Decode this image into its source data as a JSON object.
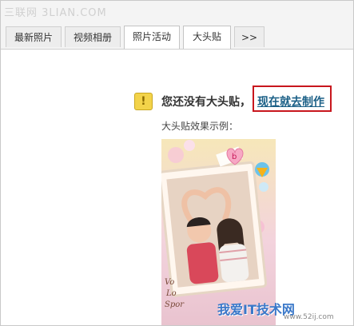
{
  "watermark_top": "三联网 3LIAN.COM",
  "tabs": [
    {
      "label": "最新照片",
      "active": false
    },
    {
      "label": "视频相册",
      "active": false
    },
    {
      "label": "照片活动",
      "active": false
    },
    {
      "label": "大头贴",
      "active": true
    },
    {
      "label": ">>",
      "active": false
    }
  ],
  "notice": {
    "icon_symbol": "!",
    "text": "您还没有大头贴，",
    "cta_label": "现在就去制作"
  },
  "example_label": "大头贴效果示例：",
  "sample_sticker": {
    "letter": "b",
    "side_text": [
      "Vo",
      "Lo",
      "Spor"
    ]
  },
  "watermark_bottom": {
    "brand": "我爱IT技术网",
    "url": "www.52ij.com"
  },
  "colors": {
    "accent_link": "#1a5f86",
    "highlight_border": "#c8161d",
    "notice_icon": "#f3d34a"
  }
}
